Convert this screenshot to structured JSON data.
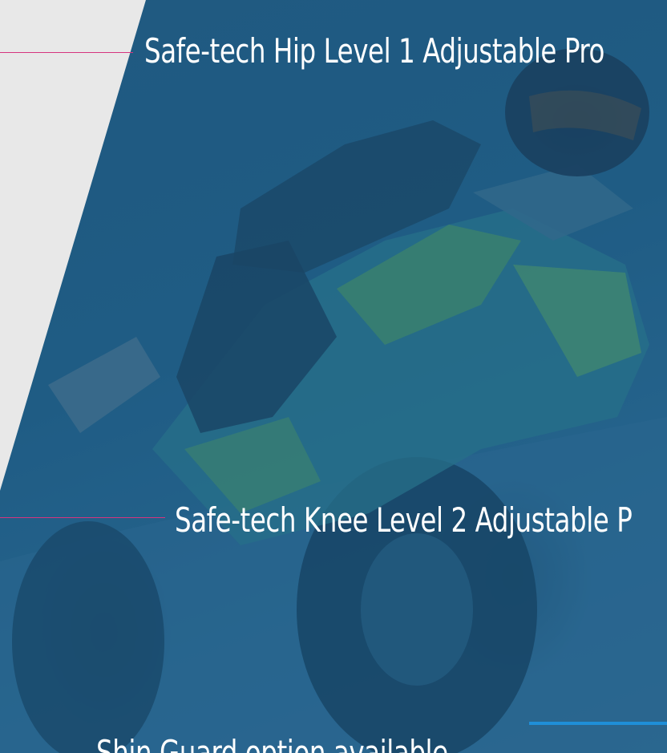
{
  "callouts": {
    "hip": {
      "text": "Safe-tech Hip Level 1 Adjustable Pro"
    },
    "knee": {
      "text": "Safe-tech Knee Level 2 Adjustable P"
    },
    "shin": {
      "text": "Shin Guard option available"
    }
  },
  "colors": {
    "background": "#e8e8e8",
    "photo_overlay": "#1f5c84",
    "leader_line": "#d6347f",
    "accent_bar": "#1f8fd8",
    "text": "#ffffff"
  }
}
